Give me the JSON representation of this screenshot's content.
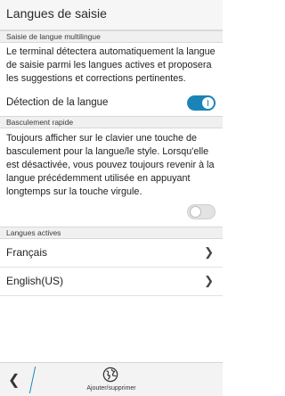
{
  "header": {
    "title": "Langues de saisie"
  },
  "multilingual": {
    "section_label": "Saisie de langue multilingue",
    "description": "Le terminal détectera automatiquement la langue de saisie parmi les langues actives et proposera les suggestions et corrections pertinentes.",
    "detection_label": "Détection de la langue",
    "detection_enabled": true
  },
  "quick_switch": {
    "section_label": "Basculement rapide",
    "description": "Toujours afficher sur le clavier une touche de basculement pour la langue/le style. Lorsqu'elle est désactivée, vous pouvez toujours revenir à la langue précédemment utilisée en appuyant longtemps sur la touche virgule.",
    "enabled": false
  },
  "active_languages": {
    "section_label": "Langues actives",
    "items": [
      {
        "label": "Français"
      },
      {
        "label": "English(US)"
      }
    ]
  },
  "bottom_bar": {
    "back_icon": "chevron-left-icon",
    "action_icon": "globe-icon",
    "action_label": "Ajouter/supprimer"
  },
  "colors": {
    "accent": "#1a84b8"
  }
}
